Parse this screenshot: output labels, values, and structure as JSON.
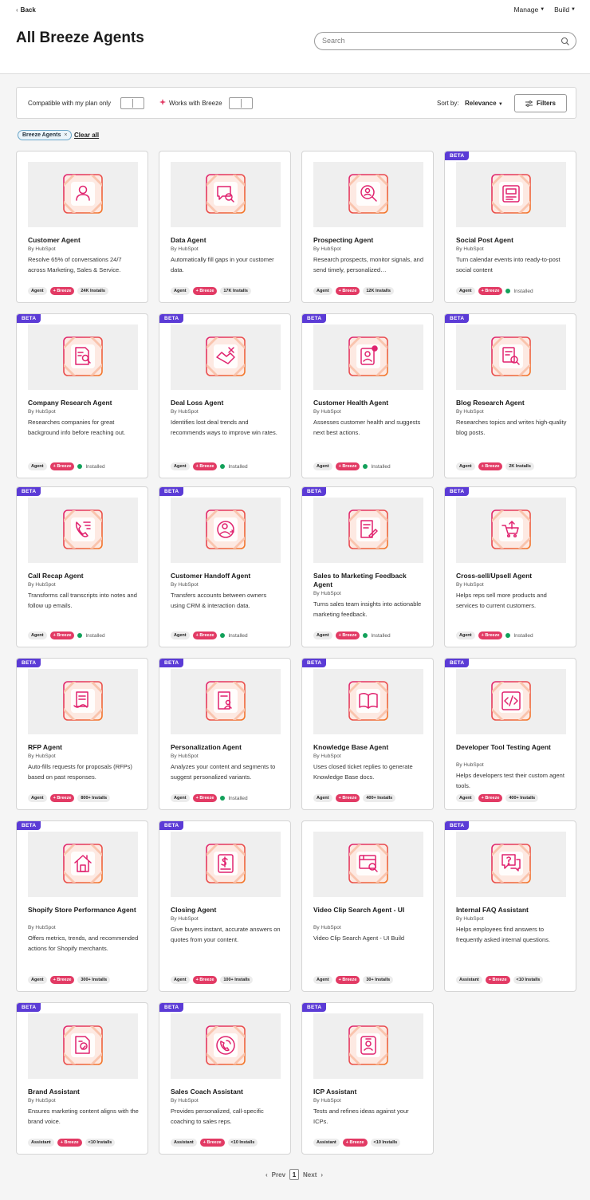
{
  "header": {
    "back_label": "Back",
    "nav": [
      {
        "label": "Manage"
      },
      {
        "label": "Build"
      }
    ],
    "title": "All Breeze Agents",
    "search_placeholder": "Search"
  },
  "filterbar": {
    "compatible_label": "Compatible with my plan only",
    "breeze_label": "Works with Breeze",
    "sort_label": "Sort by:",
    "sort_value": "Relevance",
    "filters_label": "Filters"
  },
  "active_filters": {
    "chip": "Breeze Agents",
    "clear_label": "Clear all"
  },
  "colors": {
    "beta": "#5b3bd6",
    "breeze": "#e23a64",
    "installed": "#12a15a",
    "icon_pink": "#e0226e"
  },
  "agents": [
    {
      "name": "Customer Agent",
      "by": "By HubSpot",
      "desc": "Resolve 65% of conversations 24/7 across Marketing, Sales & Service.",
      "beta": false,
      "type": "Agent",
      "breeze": "+ Breeze",
      "status": "24K Installs",
      "icon": "person-icon"
    },
    {
      "name": "Data Agent",
      "by": "By HubSpot",
      "desc": "Automatically fill gaps in your customer data.",
      "beta": false,
      "type": "Agent",
      "breeze": "+ Breeze",
      "status": "17K Installs",
      "icon": "chat-search-icon"
    },
    {
      "name": "Prospecting Agent",
      "by": "By HubSpot",
      "desc": "Research prospects, monitor signals, and send timely, personalized…",
      "beta": false,
      "type": "Agent",
      "breeze": "+ Breeze",
      "status": "12K Installs",
      "icon": "person-search-icon"
    },
    {
      "name": "Social Post Agent",
      "by": "By HubSpot",
      "desc": "Turn calendar events into ready-to-post social content",
      "beta": true,
      "type": "Agent",
      "breeze": "+ Breeze",
      "status": "Installed",
      "icon": "image-post-icon"
    },
    {
      "name": "Company Research Agent",
      "by": "By HubSpot",
      "desc": "Researches companies for great background info before reaching out.",
      "beta": true,
      "type": "Agent",
      "breeze": "+ Breeze",
      "status": "Installed",
      "icon": "document-search-icon"
    },
    {
      "name": "Deal Loss Agent",
      "by": "By HubSpot",
      "desc": "Identifies lost deal trends and recommends ways to improve win rates.",
      "beta": true,
      "type": "Agent",
      "breeze": "+ Breeze",
      "status": "Installed",
      "icon": "handshake-x-icon"
    },
    {
      "name": "Customer Health Agent",
      "by": "By HubSpot",
      "desc": "Assesses customer health and suggests next best actions.",
      "beta": true,
      "type": "Agent",
      "breeze": "+ Breeze",
      "status": "Installed",
      "icon": "contact-alert-icon"
    },
    {
      "name": "Blog Research Agent",
      "by": "By HubSpot",
      "desc": "Researches topics and writes high-quality blog posts.",
      "beta": true,
      "type": "Agent",
      "breeze": "+ Breeze",
      "status": "2K Installs",
      "icon": "blog-search-icon"
    },
    {
      "name": "Call Recap Agent",
      "by": "By HubSpot",
      "desc": "Transforms call transcripts into notes and follow up emails.",
      "beta": true,
      "type": "Agent",
      "breeze": "+ Breeze",
      "status": "Installed",
      "icon": "phone-call-icon"
    },
    {
      "name": "Customer Handoff Agent",
      "by": "By HubSpot",
      "desc": "Transfers accounts between owners using CRM & interaction data.",
      "beta": true,
      "type": "Agent",
      "breeze": "+ Breeze",
      "status": "Installed",
      "icon": "person-handoff-icon"
    },
    {
      "name": "Sales to Marketing Feedback Agent",
      "by": "By HubSpot",
      "desc": "Turns sales team insights into actionable marketing feedback.",
      "beta": true,
      "type": "Agent",
      "breeze": "+ Breeze",
      "status": "Installed",
      "icon": "feedback-doc-icon"
    },
    {
      "name": "Cross-sell/Upsell Agent",
      "by": "By HubSpot",
      "desc": "Helps reps sell more products and services to current customers.",
      "beta": true,
      "type": "Agent",
      "breeze": "+ Breeze",
      "status": "Installed",
      "icon": "cart-up-icon"
    },
    {
      "name": "RFP Agent",
      "by": "By HubSpot",
      "desc": "Auto-fills requests for proposals (RFPs) based on past responses.",
      "beta": true,
      "type": "Agent",
      "breeze": "+ Breeze",
      "status": "800+ Installs",
      "icon": "proposal-doc-icon"
    },
    {
      "name": "Personalization Agent",
      "by": "By HubSpot",
      "desc": "Analyzes your content and segments to suggest personalized variants.",
      "beta": true,
      "type": "Agent",
      "breeze": "+ Breeze",
      "status": "Installed",
      "icon": "personalized-doc-icon"
    },
    {
      "name": "Knowledge Base Agent",
      "by": "By HubSpot",
      "desc": "Uses closed ticket replies to generate Knowledge Base docs.",
      "beta": true,
      "type": "Agent",
      "breeze": "+ Breeze",
      "status": "400+ Installs",
      "icon": "book-icon"
    },
    {
      "name": "Developer Tool Testing Agent",
      "by": "By HubSpot",
      "desc": "Helps developers test their custom agent tools.",
      "beta": true,
      "type": "Agent",
      "breeze": "+ Breeze",
      "status": "400+ Installs",
      "icon": "code-icon"
    },
    {
      "name": "Shopify Store Performance Agent",
      "by": "By HubSpot",
      "desc": "Offers metrics, trends, and recommended actions for Shopify merchants.",
      "beta": true,
      "type": "Agent",
      "breeze": "+ Breeze",
      "status": "300+ Installs",
      "icon": "store-icon"
    },
    {
      "name": "Closing Agent",
      "by": "By HubSpot",
      "desc": "Give buyers instant, accurate answers on quotes from your content.",
      "beta": true,
      "type": "Agent",
      "breeze": "+ Breeze",
      "status": "100+ Installs",
      "icon": "dollar-doc-icon"
    },
    {
      "name": "Video Clip Search Agent - UI",
      "by": "By HubSpot",
      "desc": "Video Clip Search Agent - UI Build",
      "beta": false,
      "type": "Agent",
      "breeze": "+ Breeze",
      "status": "30+ Installs",
      "icon": "video-search-icon"
    },
    {
      "name": "Internal FAQ Assistant",
      "by": "By HubSpot",
      "desc": "Helps employees find answers to frequently asked internal questions.",
      "beta": true,
      "type": "Assistant",
      "breeze": "+ Breeze",
      "status": "<10 Installs",
      "icon": "question-chat-icon"
    },
    {
      "name": "Brand Assistant",
      "by": "By HubSpot",
      "desc": "Ensures marketing content aligns with the brand voice.",
      "beta": true,
      "type": "Assistant",
      "breeze": "+ Breeze",
      "status": "<10 Installs",
      "icon": "brand-doc-icon"
    },
    {
      "name": "Sales Coach Assistant",
      "by": "By HubSpot",
      "desc": "Provides personalized, call-specific coaching to sales reps.",
      "beta": true,
      "type": "Assistant",
      "breeze": "+ Breeze",
      "status": "<10 Installs",
      "icon": "coach-call-icon"
    },
    {
      "name": "ICP Assistant",
      "by": "By HubSpot",
      "desc": "Tests and refines ideas against your ICPs.",
      "beta": true,
      "type": "Assistant",
      "breeze": "+ Breeze",
      "status": "<10 Installs",
      "icon": "id-badge-icon"
    }
  ],
  "pagination": {
    "prev": "Prev",
    "page": "1",
    "next": "Next"
  }
}
